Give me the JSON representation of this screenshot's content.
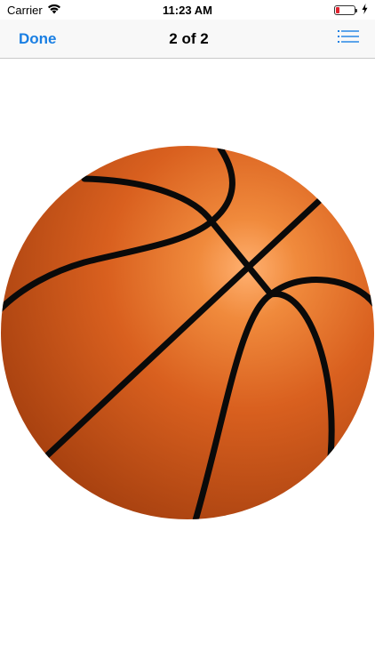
{
  "status_bar": {
    "carrier": "Carrier",
    "time": "11:23 AM",
    "battery_level": 0.18,
    "battery_color": "#e0232f",
    "wifi_icon": "wifi-icon",
    "charging_icon": "bolt-icon"
  },
  "nav": {
    "done_label": "Done",
    "title": "2 of 2",
    "list_icon": "list-icon",
    "accent_color": "#1a7fe3"
  },
  "content": {
    "image_icon": "basketball-icon"
  }
}
